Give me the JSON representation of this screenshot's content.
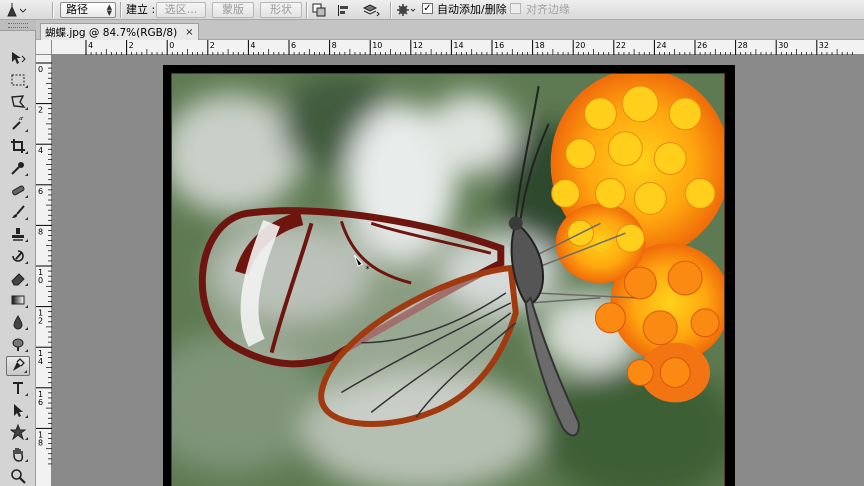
{
  "options_bar": {
    "mode_select": "路径",
    "make_label": "建立 :",
    "selection_button": "选区...",
    "mask_button": "蒙版",
    "shape_button": "形状",
    "auto_add_delete": {
      "label": "自动添加/删除",
      "checked": true
    },
    "align_edges": {
      "label": "对齐边缘",
      "checked": false
    }
  },
  "document": {
    "tab_title": "蝴蝶.jpg @ 84.7%(RGB/8)",
    "close_glyph": "×"
  },
  "horizontal_ruler": {
    "labels": [
      "4",
      "2",
      "0",
      "2",
      "4",
      "6",
      "8",
      "10",
      "12",
      "14",
      "16",
      "18",
      "20",
      "22",
      "24",
      "26",
      "28",
      "30",
      "32"
    ]
  },
  "vertical_ruler": {
    "labels": [
      "0",
      "2",
      "4",
      "6",
      "8",
      "10",
      "12",
      "14",
      "16",
      "18"
    ]
  },
  "tools": [
    {
      "name": "move",
      "icon": "move-icon"
    },
    {
      "name": "marquee",
      "icon": "rectangular-marquee-icon"
    },
    {
      "name": "lasso",
      "icon": "polygonal-lasso-icon"
    },
    {
      "name": "quick-selection",
      "icon": "quick-selection-icon"
    },
    {
      "name": "crop",
      "icon": "crop-icon"
    },
    {
      "name": "eyedropper",
      "icon": "eyedropper-icon"
    },
    {
      "name": "spot-healing",
      "icon": "spot-healing-icon"
    },
    {
      "name": "brush",
      "icon": "brush-icon"
    },
    {
      "name": "clone-stamp",
      "icon": "clone-stamp-icon"
    },
    {
      "name": "history-brush",
      "icon": "history-brush-icon"
    },
    {
      "name": "eraser",
      "icon": "eraser-icon"
    },
    {
      "name": "gradient",
      "icon": "gradient-icon"
    },
    {
      "name": "blur",
      "icon": "blur-icon"
    },
    {
      "name": "dodge",
      "icon": "dodge-icon"
    },
    {
      "name": "pen",
      "icon": "pen-icon",
      "active": true
    },
    {
      "name": "type",
      "icon": "type-icon"
    },
    {
      "name": "path-selection",
      "icon": "path-selection-icon"
    },
    {
      "name": "custom-shape",
      "icon": "custom-shape-icon"
    },
    {
      "name": "hand",
      "icon": "hand-icon"
    },
    {
      "name": "zoom",
      "icon": "zoom-icon"
    }
  ],
  "colors": {
    "pasteboard": "#8a8a8a",
    "canvas_border": "#000000"
  },
  "photo": {
    "subject": "glasswing butterfly on orange lantana flowers"
  }
}
